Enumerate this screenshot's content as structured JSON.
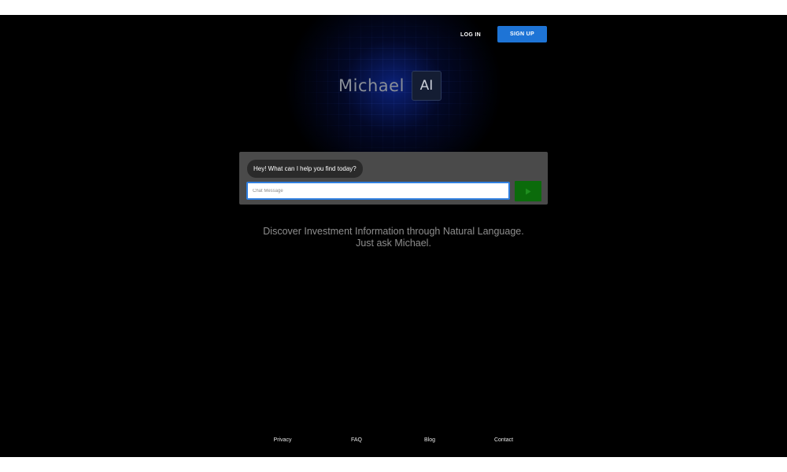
{
  "header": {
    "login_label": "LOG IN",
    "signup_label": "SIGN UP"
  },
  "logo": {
    "name": "Michael",
    "badge": "AI"
  },
  "chat": {
    "greeting": "Hey! What can I help you find today?",
    "input_value": "",
    "input_placeholder": "Chat Message",
    "send_icon": "send-arrow-icon"
  },
  "tagline": {
    "line1": "Discover Investment Information through Natural Language.",
    "line2": "Just ask Michael."
  },
  "footer": {
    "links": [
      "Privacy",
      "FAQ",
      "Blog",
      "Contact"
    ]
  },
  "colors": {
    "background": "#000000",
    "accent_blue": "#1e74d6",
    "send_green": "#0b6b0b",
    "chat_panel": "#4a4a4a"
  }
}
